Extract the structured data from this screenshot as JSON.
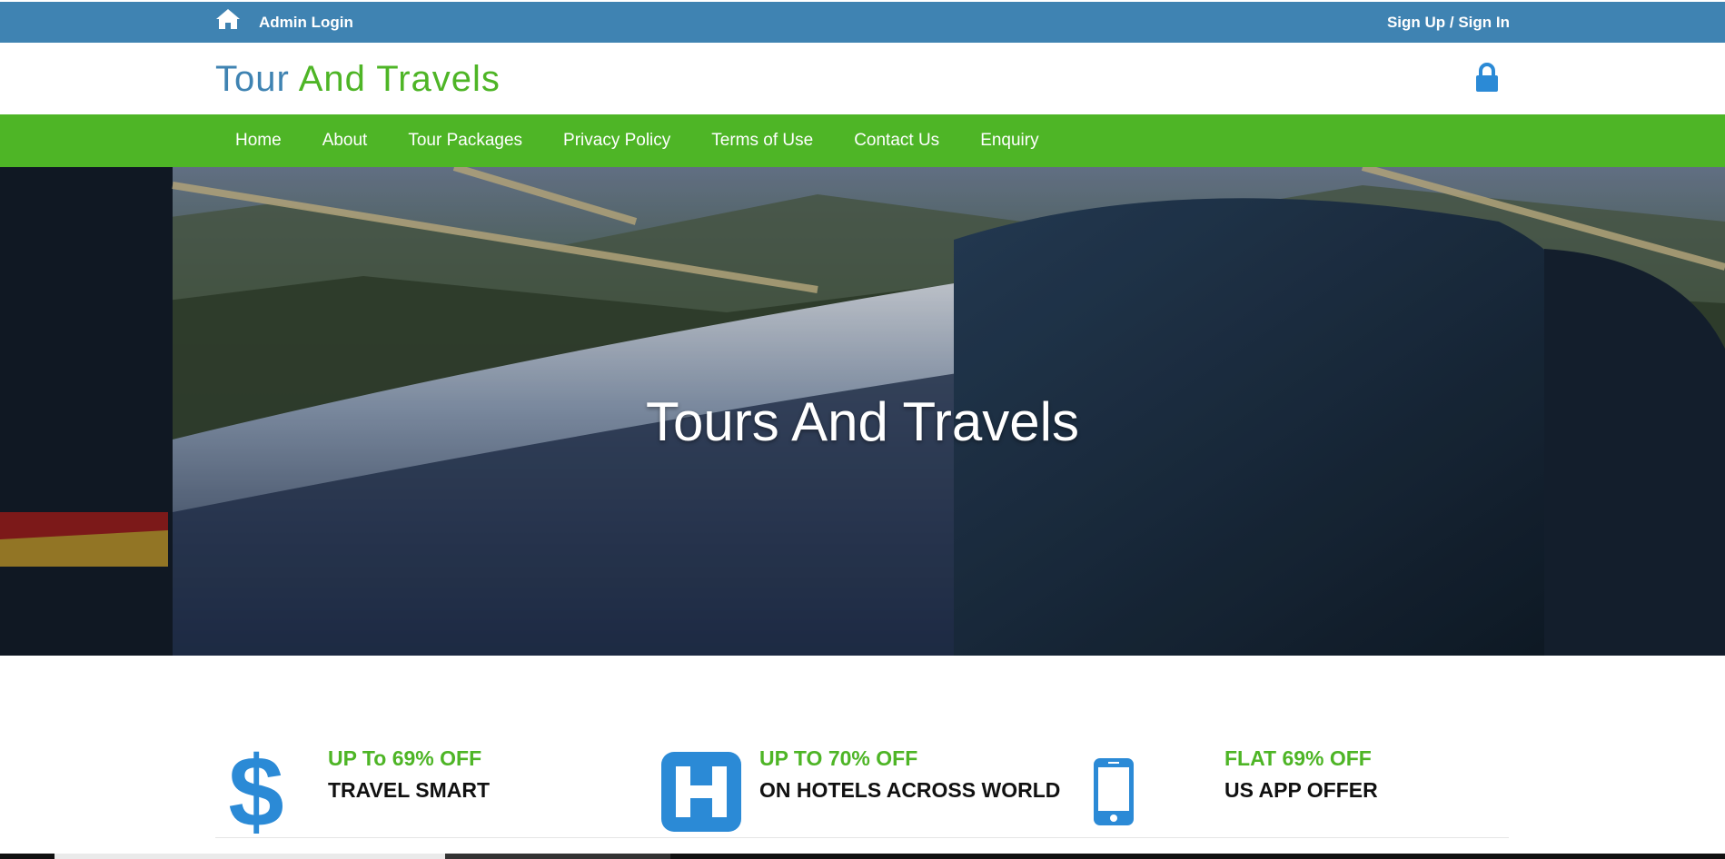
{
  "topbar": {
    "admin_login": "Admin Login",
    "signup_signin": "Sign Up / Sign In"
  },
  "header": {
    "logo_part1": "Tour ",
    "logo_part2": "And Travels"
  },
  "nav": {
    "items": [
      {
        "label": "Home"
      },
      {
        "label": "About"
      },
      {
        "label": "Tour Packages"
      },
      {
        "label": "Privacy Policy"
      },
      {
        "label": "Terms of Use"
      },
      {
        "label": "Contact Us"
      },
      {
        "label": "Enquiry"
      }
    ]
  },
  "hero": {
    "title": "Tours And Travels"
  },
  "features": [
    {
      "icon": "dollar-icon",
      "title": "UP To 69% OFF",
      "subtitle": "TRAVEL SMART"
    },
    {
      "icon": "hotel-icon",
      "title": "UP TO 70% OFF",
      "subtitle": "ON HOTELS ACROSS WORLD"
    },
    {
      "icon": "mobile-phone-icon",
      "title": "FLAT 69% OFF",
      "subtitle": "US APP OFFER"
    }
  ],
  "colors": {
    "topbar": "#3f83b2",
    "nav": "#4eb526",
    "accent_blue": "#2b8ad6",
    "accent_green": "#4eb526"
  }
}
